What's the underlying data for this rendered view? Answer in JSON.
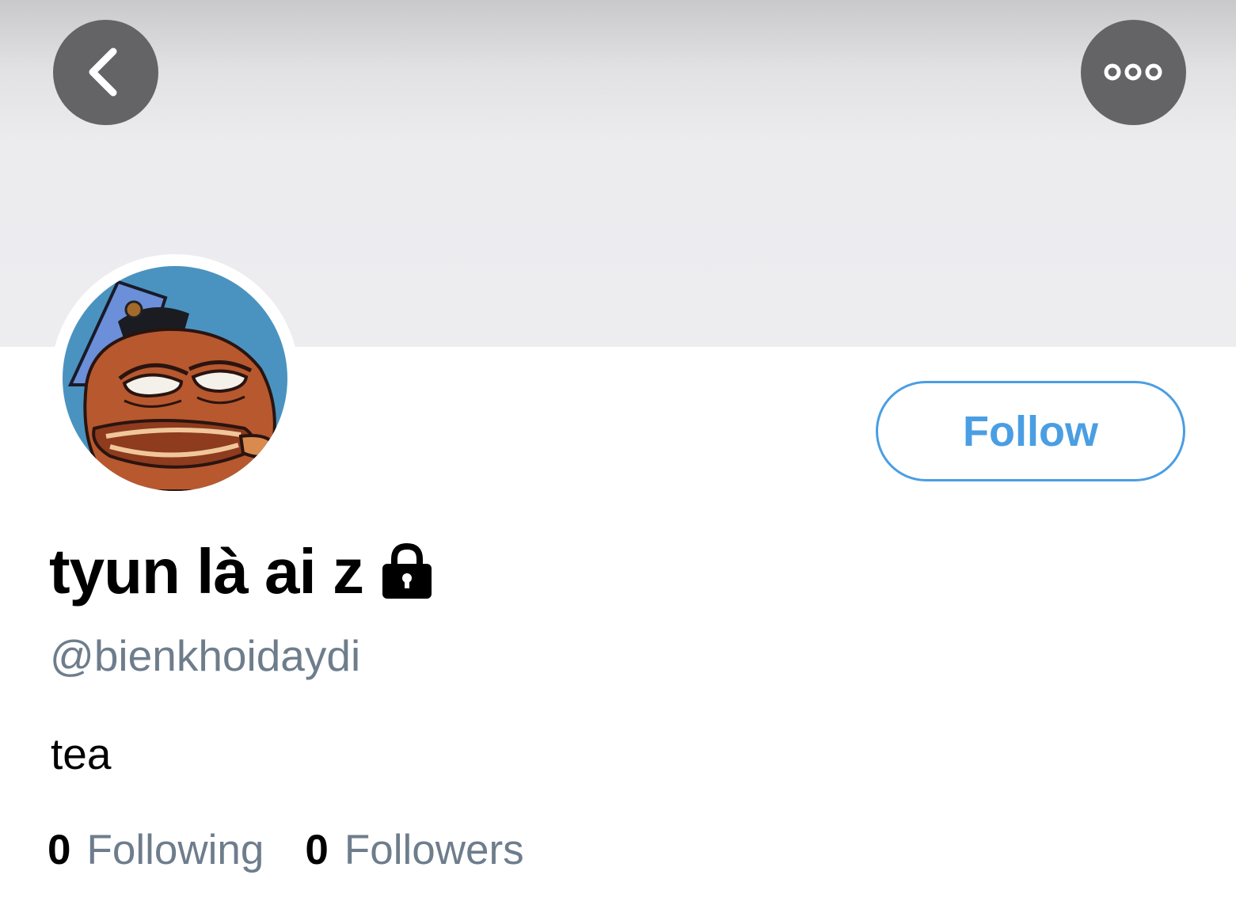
{
  "header": {
    "back_icon": "chevron-left-icon",
    "more_icon": "ellipsis-icon"
  },
  "profile": {
    "display_name": "tyun là ai z",
    "protected_icon": "lock-icon",
    "handle": "@bienkhoidaydi",
    "bio": "tea",
    "follow_label": "Follow",
    "following_count": "0",
    "following_label": "Following",
    "followers_count": "0",
    "followers_label": "Followers"
  },
  "colors": {
    "accent": "#4a9ee3",
    "secondary_text": "#6e7d8c",
    "banner": "#ededf0",
    "nav_button": "#646466"
  }
}
